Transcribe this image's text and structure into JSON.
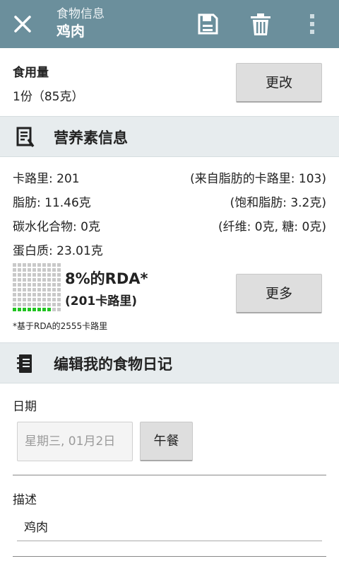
{
  "appbar": {
    "subtitle": "食物信息",
    "title": "鸡肉",
    "close_icon": "close-icon",
    "save_icon": "save-icon",
    "delete_icon": "trash-icon",
    "menu_icon": "overflow-menu-icon",
    "color": "#6b8f9c"
  },
  "serving": {
    "label": "食用量",
    "value": "1份（85克）",
    "button": "更改"
  },
  "nutrition": {
    "header": "营养素信息",
    "left": [
      "卡路里: 201",
      "脂肪: 11.46克",
      "碳水化合物: 0克",
      "蛋白质: 23.01克"
    ],
    "right": [
      "(来自脂肪的卡路里: 103)",
      "(饱和脂肪: 3.2克)",
      "(纤维: 0克, 糖: 0克)"
    ],
    "rda_percent": "8%的RDA*",
    "rda_calories": "(201卡路里)",
    "rda_fraction": 0.08,
    "more_button": "更多",
    "footnote": "*基于RDA的2555卡路里"
  },
  "diary": {
    "header": "编辑我的食物日记",
    "date_label": "日期",
    "date_value": "星期三, 01月2日",
    "meal_button": "午餐",
    "desc_label": "描述",
    "desc_value": "鸡肉"
  }
}
